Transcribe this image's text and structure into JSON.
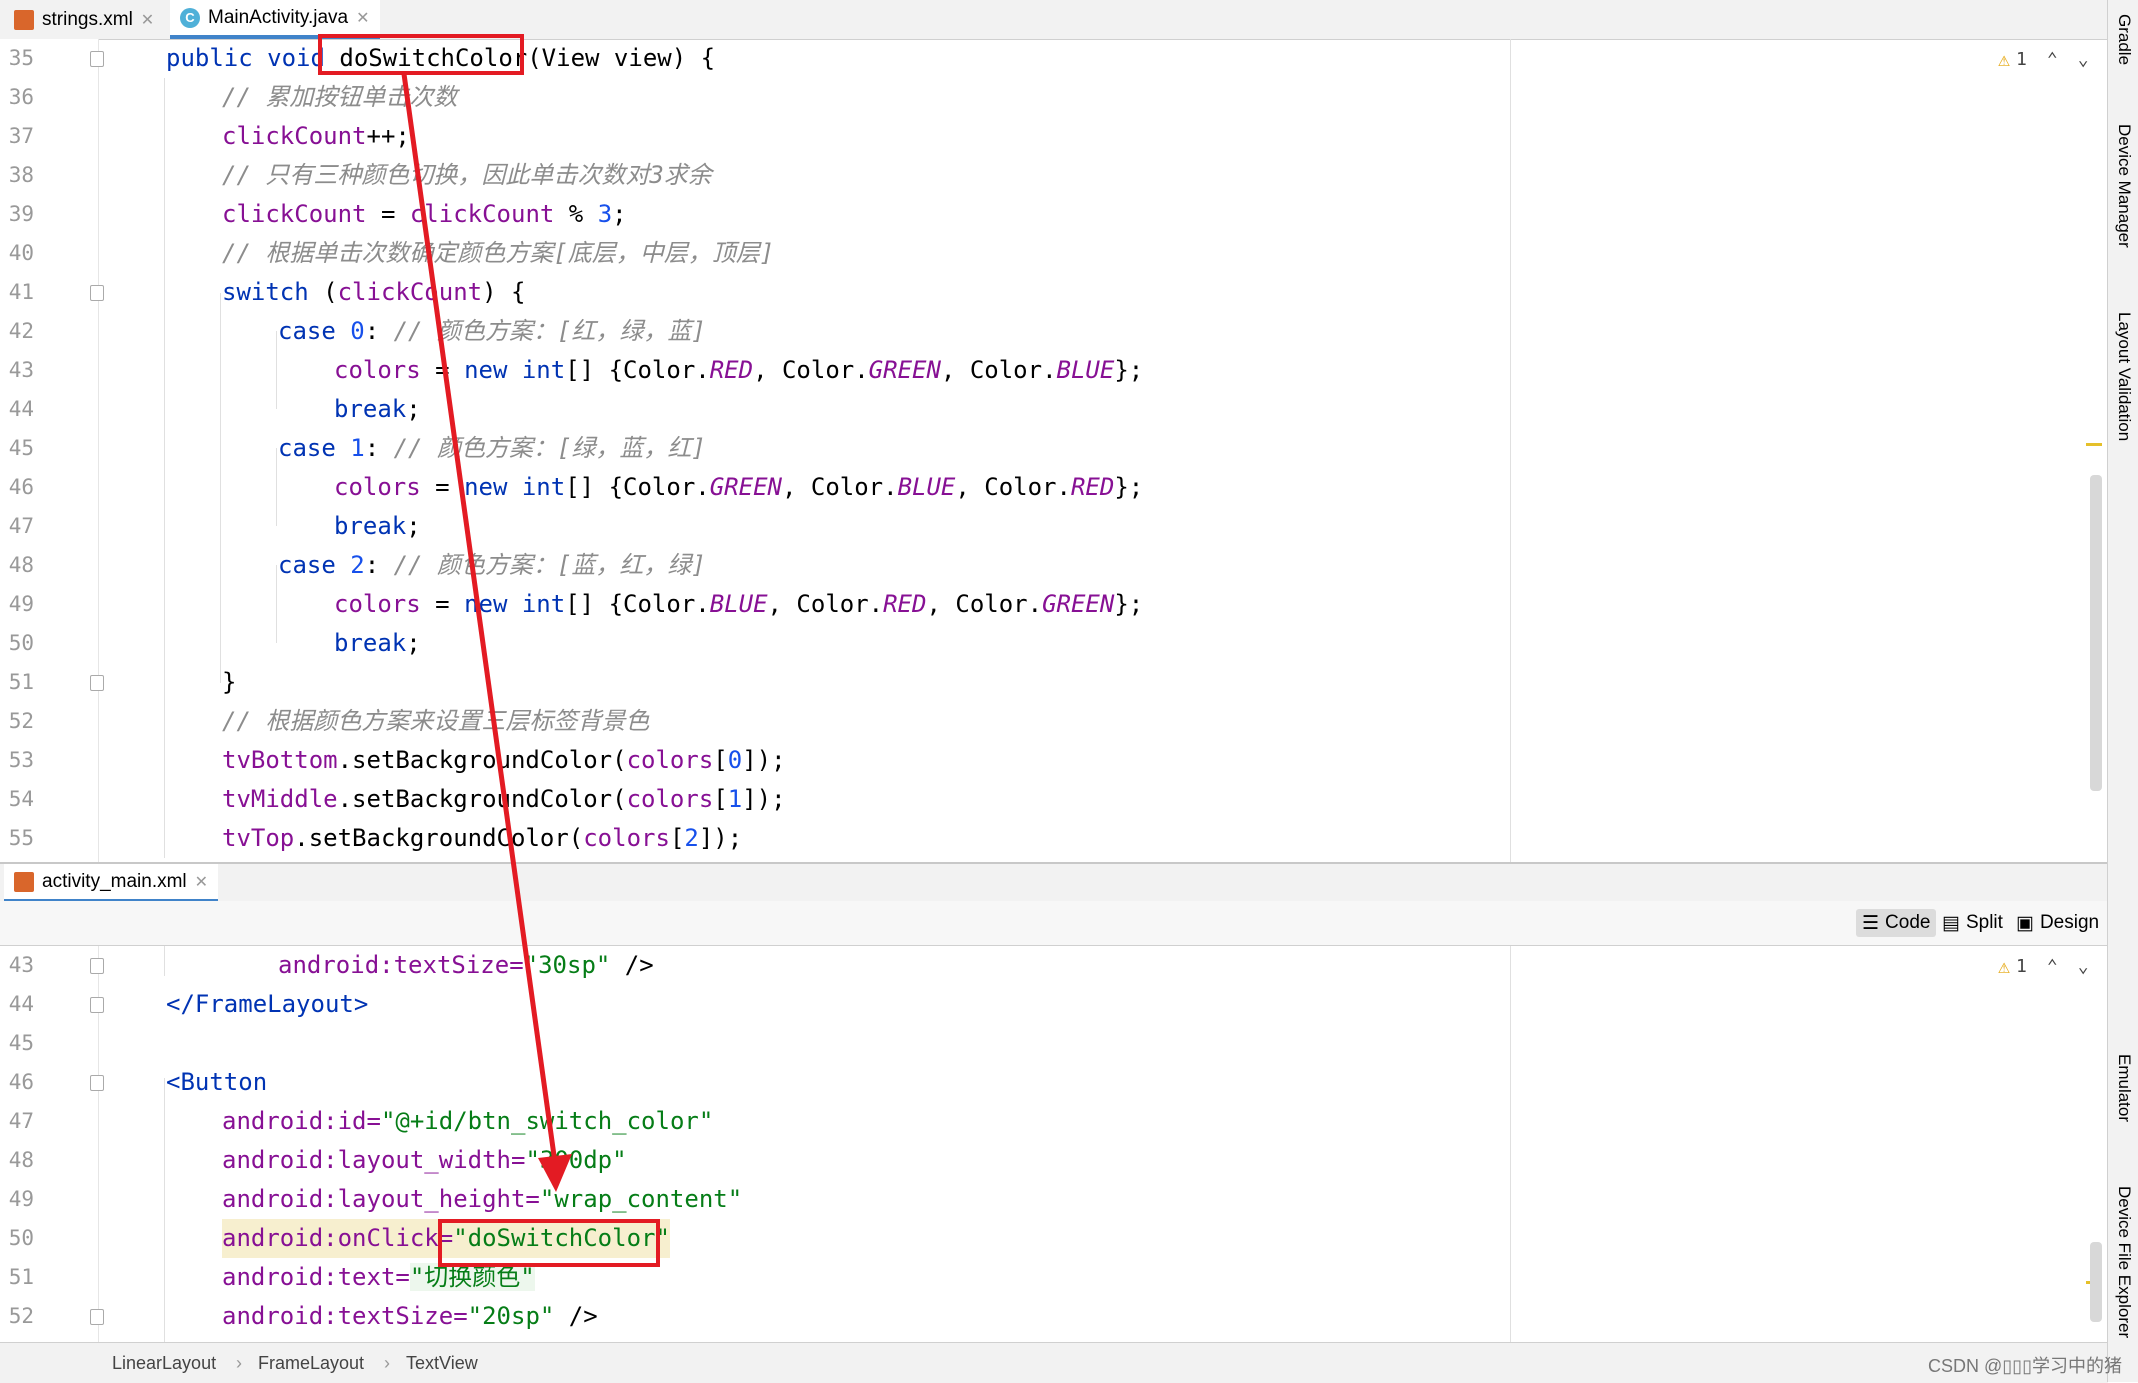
{
  "top_tabs": [
    {
      "label": "strings.xml",
      "active": false
    },
    {
      "label": "MainActivity.java",
      "active": true
    }
  ],
  "bottom_tab": {
    "label": "activity_main.xml"
  },
  "warning_count": "1",
  "view_modes": {
    "code": "Code",
    "split": "Split",
    "design": "Design"
  },
  "right_tools": [
    "Gradle",
    "Device Manager",
    "Layout Validation",
    "Emulator",
    "Device File Explorer"
  ],
  "breadcrumb": [
    "LinearLayout",
    "FrameLayout",
    "TextView"
  ],
  "watermark": "CSDN @▯▯▯学习中的猪",
  "java_lines": {
    "n35": "35",
    "n36": "36",
    "n37": "37",
    "n38": "38",
    "n39": "39",
    "n40": "40",
    "n41": "41",
    "n42": "42",
    "n43": "43",
    "n44": "44",
    "n45": "45",
    "n46": "46",
    "n47": "47",
    "n48": "48",
    "n49": "49",
    "n50": "50",
    "n51": "51",
    "n52": "52",
    "n53": "53",
    "n54": "54",
    "n55": "55"
  },
  "java_code": {
    "l35_kw": "public void ",
    "l35_fn": "doSwitchColor",
    "l35_rest": "(View view) {",
    "l36": "// 累加按钮单击次数",
    "l37_fld": "clickCount",
    "l37_rest": "++;",
    "l38": "// 只有三种颜色切换，因此单击次数对3求余",
    "l39_a": "clickCount",
    "l39_b": " = ",
    "l39_c": "clickCount",
    "l39_d": " % ",
    "l39_e": "3",
    "l39_f": ";",
    "l40": "// 根据单击次数确定颜色方案[底层，中层，顶层]",
    "l41_kw": "switch",
    "l41_a": " (",
    "l41_b": "clickCount",
    "l41_c": ") {",
    "l42_kw": "case ",
    "l42_n": "0",
    "l42_c": ": ",
    "l42_cm": "// 颜色方案：[红，绿，蓝]",
    "l43_a": "colors",
    "l43_b": " = ",
    "l43_kw": "new int",
    "l43_c": "[] {Color.",
    "l43_d": "RED",
    "l43_e": ", Color.",
    "l43_f": "GREEN",
    "l43_g": ", Color.",
    "l43_h": "BLUE",
    "l43_i": "};",
    "l44": "break",
    "l45_kw": "case ",
    "l45_n": "1",
    "l45_c": ": ",
    "l45_cm": "// 颜色方案：[绿，蓝，红]",
    "l46_a": "colors",
    "l46_b": " = ",
    "l46_kw": "new int",
    "l46_c": "[] {Color.",
    "l46_d": "GREEN",
    "l46_e": ", Color.",
    "l46_f": "BLUE",
    "l46_g": ", Color.",
    "l46_h": "RED",
    "l46_i": "};",
    "l47": "break",
    "l48_kw": "case ",
    "l48_n": "2",
    "l48_c": ": ",
    "l48_cm": "// 颜色方案：[蓝，红，绿]",
    "l49_a": "colors",
    "l49_b": " = ",
    "l49_kw": "new int",
    "l49_c": "[] {Color.",
    "l49_d": "BLUE",
    "l49_e": ", Color.",
    "l49_f": "RED",
    "l49_g": ", Color.",
    "l49_h": "GREEN",
    "l49_i": "};",
    "l50": "break",
    "l51": "}",
    "l52": "// 根据颜色方案来设置三层标签背景色",
    "l53_a": "tvBottom",
    "l53_b": ".setBackgroundColor(",
    "l53_c": "colors",
    "l53_d": "[",
    "l53_e": "0",
    "l53_f": "]);",
    "l54_a": "tvMiddle",
    "l54_b": ".setBackgroundColor(",
    "l54_c": "colors",
    "l54_d": "[",
    "l54_e": "1",
    "l54_f": "]);",
    "l55_a": "tvTop",
    "l55_b": ".setBackgroundColor(",
    "l55_c": "colors",
    "l55_d": "[",
    "l55_e": "2",
    "l55_f": "]);"
  },
  "xml_lines": {
    "n43": "43",
    "n44": "44",
    "n45": "45",
    "n46": "46",
    "n47": "47",
    "n48": "48",
    "n49": "49",
    "n50": "50",
    "n51": "51",
    "n52": "52"
  },
  "xml_code": {
    "l43_attr": "android:textSize=",
    "l43_val": "\"30sp\"",
    "l43_end": " />",
    "l44": "</FrameLayout>",
    "l46": "<Button",
    "l47_attr": "android:id=",
    "l47_val": "\"@+id/btn_switch_color\"",
    "l48_attr": "android:layout_width=",
    "l48_val": "\"300dp\"",
    "l49_attr": "android:layout_height=",
    "l49_val": "\"wrap_content\"",
    "l50_attr": "android:onClick=",
    "l50_val": "\"doSwitchColor\"",
    "l51_attr": "android:text=",
    "l51_val": "\"切换颜色\"",
    "l52_attr": "android:textSize=",
    "l52_val": "\"20sp\"",
    "l52_end": " />"
  },
  "colors": {
    "annotation": "#e31b23",
    "keyword": "#0033b3",
    "field": "#871094",
    "string": "#067d17",
    "comment": "#8c8c8c"
  }
}
